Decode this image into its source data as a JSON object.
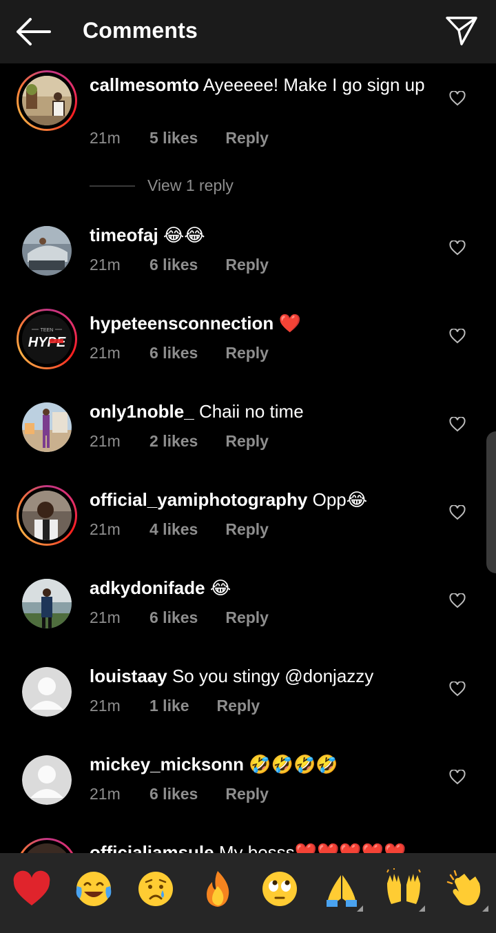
{
  "header": {
    "title": "Comments",
    "back_icon": "arrow-left-icon",
    "send_icon": "paper-plane-icon"
  },
  "comments": [
    {
      "username": "callmesomto",
      "text": "Ayeeeee! Make I go sign up",
      "time": "21m",
      "likes": "5 likes",
      "reply": "Reply",
      "view_replies": "View 1 reply",
      "ring": true
    },
    {
      "username": "timeofaj",
      "text": "😂😂",
      "time": "21m",
      "likes": "6 likes",
      "reply": "Reply",
      "ring": false
    },
    {
      "username": "hypeteensconnection",
      "text": "❤️",
      "time": "21m",
      "likes": "6 likes",
      "reply": "Reply",
      "ring": true
    },
    {
      "username": "only1noble_",
      "text": "Chaii no time",
      "time": "21m",
      "likes": "2 likes",
      "reply": "Reply",
      "ring": false
    },
    {
      "username": "official_yamiphotography",
      "text": "Opp😂",
      "time": "21m",
      "likes": "4 likes",
      "reply": "Reply",
      "ring": true
    },
    {
      "username": "adkydonifade",
      "text": "😂",
      "time": "21m",
      "likes": "6 likes",
      "reply": "Reply",
      "ring": false
    },
    {
      "username": "louistaay",
      "text": "So you stingy @donjazzy",
      "time": "21m",
      "likes": "1 like",
      "reply": "Reply",
      "ring": false
    },
    {
      "username": "mickey_micksonn",
      "text": "🤣🤣🤣🤣",
      "time": "21m",
      "likes": "6 likes",
      "reply": "Reply",
      "ring": false
    },
    {
      "username": "officialiamsule",
      "text": "My bosss❤️❤️❤️❤️❤️",
      "ring": true
    }
  ],
  "avatar_logo_text": {
    "small": "TEEN",
    "big": "HYPE"
  },
  "emoji_bar": [
    {
      "name": "red-heart",
      "char": "❤️"
    },
    {
      "name": "tears-of-joy",
      "char": "😂"
    },
    {
      "name": "sad-relieved",
      "char": "😥"
    },
    {
      "name": "fire",
      "char": "🔥"
    },
    {
      "name": "eye-roll",
      "char": "🙄"
    },
    {
      "name": "folded-hands",
      "char": "🙏"
    },
    {
      "name": "raising-hands",
      "char": "🙌"
    },
    {
      "name": "clapping-hands",
      "char": "👏"
    }
  ],
  "colors": {
    "header_bg": "#1b1b1b",
    "secondary_text": "#8e8e8e",
    "emoji_bar_bg": "#262626",
    "story_ring": "#e1306c"
  }
}
